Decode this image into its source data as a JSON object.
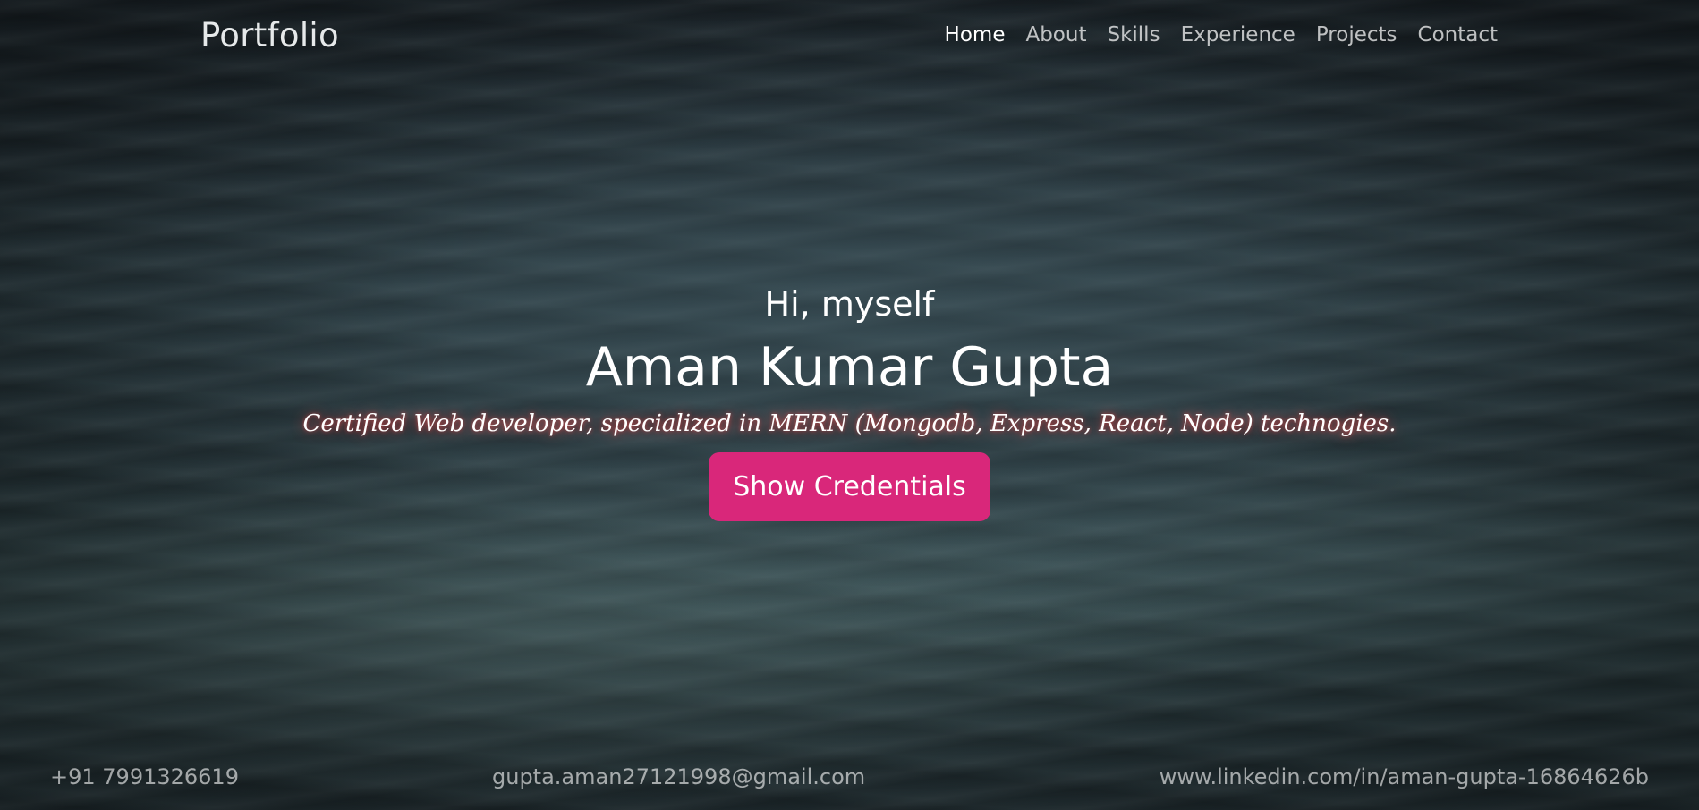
{
  "navbar": {
    "brand": "Portfolio",
    "links": [
      {
        "label": "Home",
        "active": true
      },
      {
        "label": "About",
        "active": false
      },
      {
        "label": "Skills",
        "active": false
      },
      {
        "label": "Experience",
        "active": false
      },
      {
        "label": "Projects",
        "active": false
      },
      {
        "label": "Contact",
        "active": false
      }
    ]
  },
  "hero": {
    "greeting": "Hi, myself",
    "name": "Aman Kumar Gupta",
    "tagline": "Certified Web developer, specialized in MERN (Mongodb, Express, React, Node) technogies.",
    "cta_label": "Show Credentials"
  },
  "footer": {
    "phone": "+91 7991326619",
    "email": "gupta.aman27121998@gmail.com",
    "linkedin": "www.linkedin.com/in/aman-gupta-16864626b"
  },
  "colors": {
    "accent": "#d9277a",
    "background": "#2a3a40",
    "text": "#ffffff"
  }
}
